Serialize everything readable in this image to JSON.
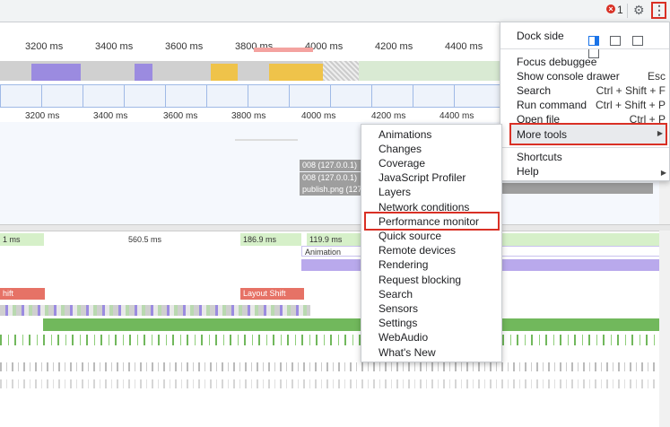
{
  "toolbar": {
    "error_count": "1",
    "error_icon": "error-x-icon",
    "settings_icon": "gear-icon",
    "menu_icon": "kebab-menu-icon"
  },
  "ruler_top": [
    "3200 ms",
    "3400 ms",
    "3600 ms",
    "3800 ms",
    "4000 ms",
    "4200 ms",
    "4400 ms"
  ],
  "ruler_bottom": [
    "3200 ms",
    "3400 ms",
    "3600 ms",
    "3800 ms",
    "4000 ms",
    "4200 ms",
    "4400 ms"
  ],
  "network": [
    "008 (127.0.0.1)",
    "008 (127.0.0.1)",
    "publish.png (127"
  ],
  "frames": [
    "1 ms",
    "560.5 ms",
    "186.9 ms",
    "119.9 ms"
  ],
  "animation_label": "Animation",
  "layout_shift_left": "hift",
  "layout_shift": "Layout Shift",
  "menu": {
    "dock_side": "Dock side",
    "items1": [
      {
        "label": "Focus debuggee",
        "shortcut": ""
      },
      {
        "label": "Show console drawer",
        "shortcut": "Esc"
      },
      {
        "label": "Search",
        "shortcut": "Ctrl + Shift + F"
      },
      {
        "label": "Run command",
        "shortcut": "Ctrl + Shift + P"
      },
      {
        "label": "Open file",
        "shortcut": "Ctrl + P"
      }
    ],
    "more_tools": "More tools",
    "items2": [
      {
        "label": "Shortcuts"
      },
      {
        "label": "Help"
      }
    ]
  },
  "submenu": [
    "Animations",
    "Changes",
    "Coverage",
    "JavaScript Profiler",
    "Layers",
    "Network conditions",
    "Performance monitor",
    "Quick source",
    "Remote devices",
    "Rendering",
    "Request blocking",
    "Search",
    "Sensors",
    "Settings",
    "WebAudio",
    "What's New"
  ],
  "colors": {
    "highlight": "#d93025",
    "cpu_script": "#efc34a",
    "cpu_render": "#9b8be0",
    "frame": "#d6f0c9",
    "layout_shift": "#e67266"
  }
}
